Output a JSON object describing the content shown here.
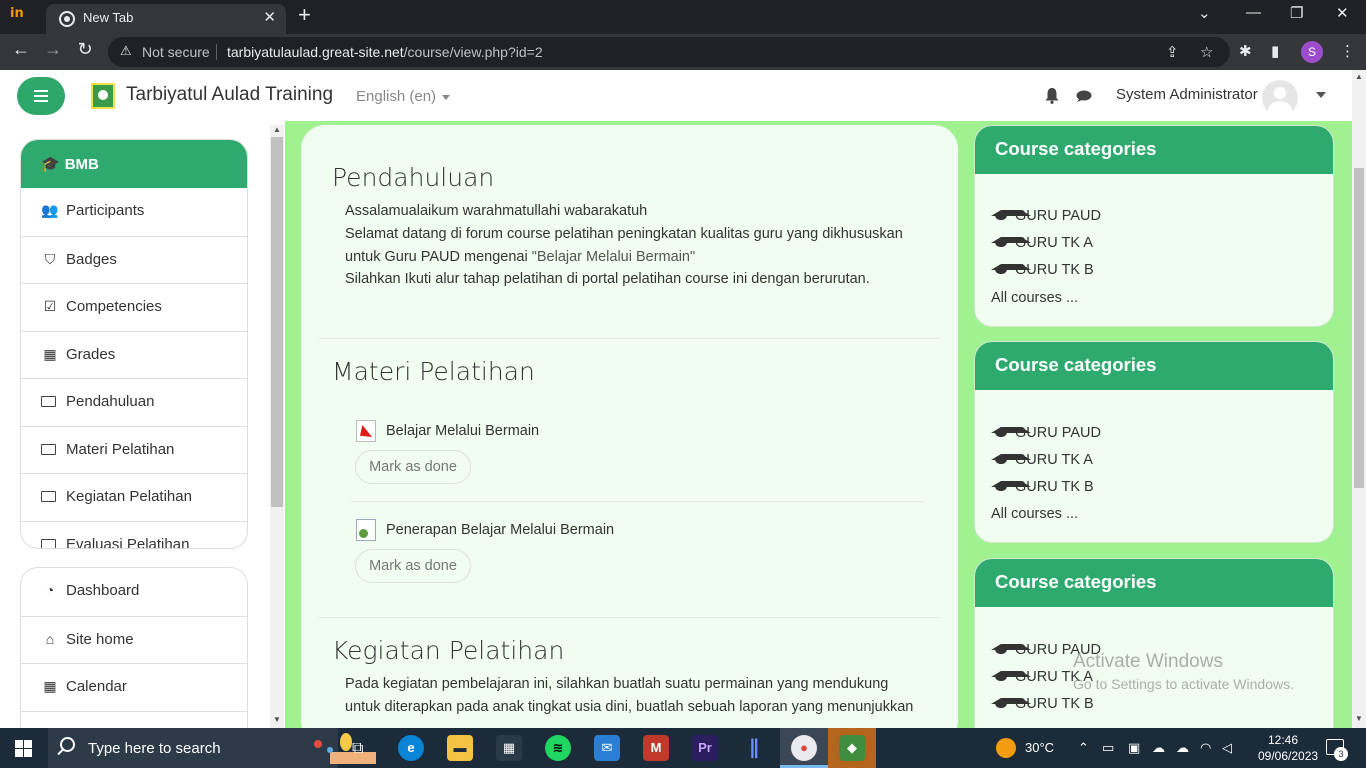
{
  "browser": {
    "tab_title": "New Tab",
    "not_secure": "Not secure",
    "url_domain": "tarbiyatulaulad.great-site.net",
    "url_path": "/course/view.php?id=2",
    "profile_initial": "S"
  },
  "navbar": {
    "site_name": "Tarbiyatul Aulad Training",
    "language": "English (en)",
    "user_name": "System Administrator"
  },
  "drawer": {
    "course_short": "BMB",
    "course_items": [
      {
        "label": "Participants",
        "icon": "users-icon"
      },
      {
        "label": "Badges",
        "icon": "shield-icon"
      },
      {
        "label": "Competencies",
        "icon": "checkbox-icon"
      },
      {
        "label": "Grades",
        "icon": "table-icon"
      },
      {
        "label": "Pendahuluan",
        "icon": "folder-icon"
      },
      {
        "label": "Materi Pelatihan",
        "icon": "folder-icon"
      },
      {
        "label": "Kegiatan Pelatihan",
        "icon": "folder-icon"
      },
      {
        "label": "Evaluasi Pelatihan",
        "icon": "folder-icon"
      }
    ],
    "site_items": [
      {
        "label": "Dashboard",
        "icon": "dashboard-icon"
      },
      {
        "label": "Site home",
        "icon": "home-icon"
      },
      {
        "label": "Calendar",
        "icon": "calendar-icon"
      }
    ]
  },
  "main": {
    "sections": [
      {
        "title": "Pendahuluan",
        "lines": [
          "Assalamualaikum warahmatullahi wabarakatuh",
          "Selamat datang di forum course pelatihan peningkatan kualitas guru yang dikhususkan",
          "untuk Guru PAUD mengenai",
          "\"Belajar Melalui Bermain\"",
          "Silahkan Ikuti alur tahap pelatihan di portal pelatihan course ini dengan berurutan."
        ]
      },
      {
        "title": "Materi Pelatihan",
        "activities": [
          {
            "name": "Belajar Melalui Bermain",
            "type": "pdf-icon",
            "button": "Mark as done"
          },
          {
            "name": "Penerapan Belajar Melalui Bermain",
            "type": "url-icon",
            "button": "Mark as done"
          }
        ]
      },
      {
        "title": "Kegiatan Pelatihan",
        "lines": [
          "Pada kegiatan pembelajaran ini, silahkan buatlah suatu permainan yang mendukung",
          "untuk diterapkan pada anak tingkat usia dini, buatlah sebuah laporan yang menunjukkan"
        ]
      }
    ]
  },
  "blocks": [
    {
      "title": "Course categories",
      "categories": [
        "GURU PAUD",
        "GURU TK A",
        "GURU TK B"
      ],
      "all": "All courses ..."
    },
    {
      "title": "Course categories",
      "categories": [
        "GURU PAUD",
        "GURU TK A",
        "GURU TK B"
      ],
      "all": "All courses ..."
    },
    {
      "title": "Course categories",
      "categories": [
        "GURU PAUD",
        "GURU TK A",
        "GURU TK B"
      ]
    }
  ],
  "watermark": {
    "line1": "Activate Windows",
    "line2": "Go to Settings to activate Windows."
  },
  "taskbar": {
    "search_placeholder": "Type here to search",
    "temperature": "30°C",
    "time": "12:46",
    "date": "09/06/2023",
    "notifications": "3"
  },
  "colors": {
    "brand": "#2eaa6e",
    "page_bg": "#9ff28f",
    "card_bg": "#f1fdf1"
  }
}
